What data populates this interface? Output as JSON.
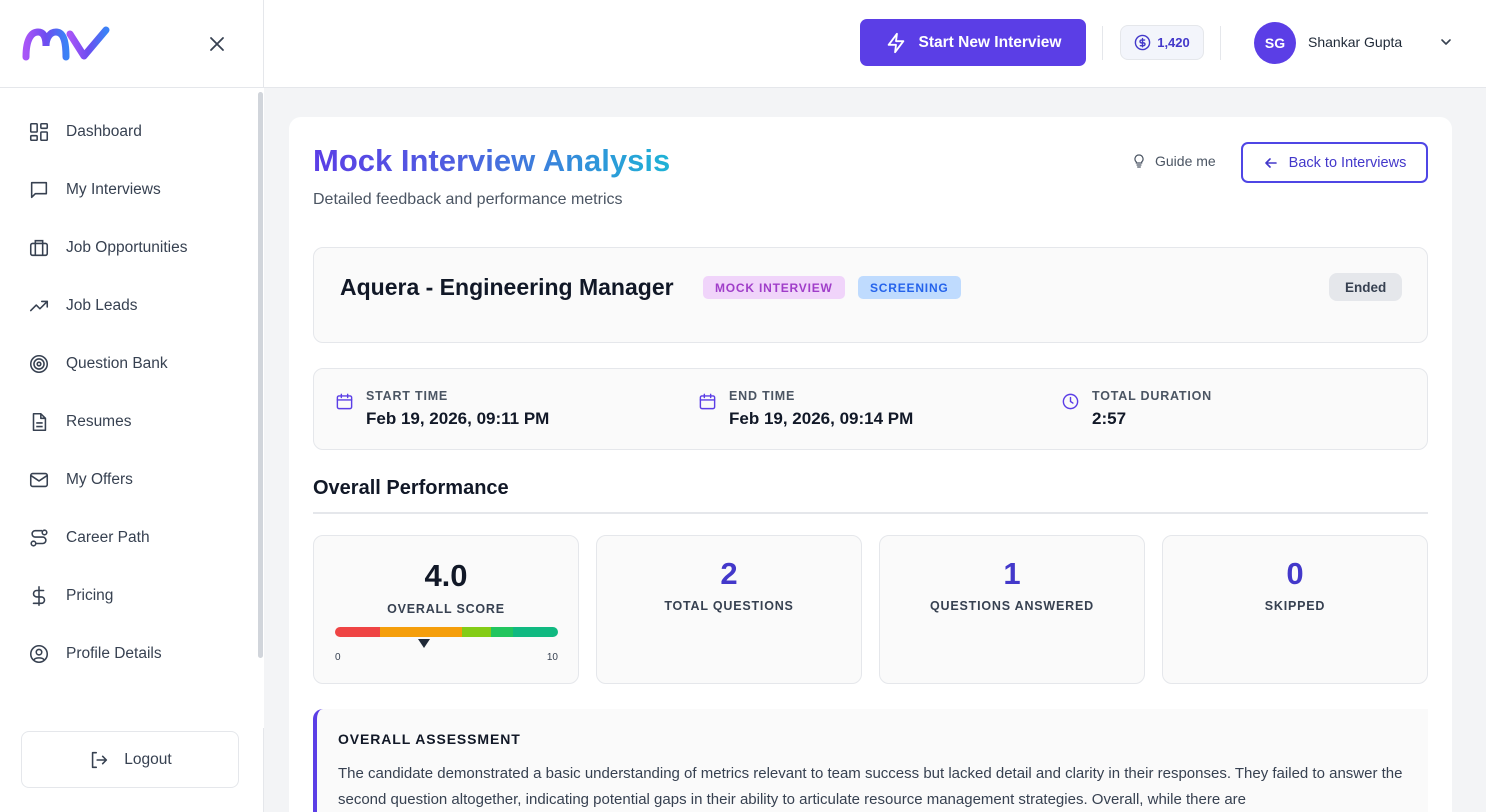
{
  "sidebar": {
    "items": [
      {
        "label": "Dashboard",
        "icon": "dashboard-icon"
      },
      {
        "label": "My Interviews",
        "icon": "chat-bubble-icon"
      },
      {
        "label": "Job Opportunities",
        "icon": "briefcase-icon"
      },
      {
        "label": "Job Leads",
        "icon": "trending-up-icon"
      },
      {
        "label": "Question Bank",
        "icon": "target-icon"
      },
      {
        "label": "Resumes",
        "icon": "document-icon"
      },
      {
        "label": "My Offers",
        "icon": "mail-icon"
      },
      {
        "label": "Career Path",
        "icon": "route-icon"
      },
      {
        "label": "Pricing",
        "icon": "dollar-icon"
      },
      {
        "label": "Profile Details",
        "icon": "user-circle-icon"
      }
    ],
    "logout_label": "Logout"
  },
  "topbar": {
    "start_label": "Start New Interview",
    "credits": "1,420",
    "avatar_initials": "SG",
    "username": "Shankar Gupta"
  },
  "page": {
    "title": "Mock Interview Analysis",
    "subtitle": "Detailed feedback and performance metrics",
    "guide_label": "Guide me",
    "back_label": "Back to Interviews"
  },
  "interview": {
    "title": "Aquera - Engineering Manager",
    "badge_type": "MOCK INTERVIEW",
    "badge_stage": "SCREENING",
    "status": "Ended"
  },
  "times": {
    "start_label": "START TIME",
    "start_value": "Feb 19, 2026, 09:11 PM",
    "end_label": "END TIME",
    "end_value": "Feb 19, 2026, 09:14 PM",
    "duration_label": "TOTAL DURATION",
    "duration_value": "2:57"
  },
  "performance": {
    "section_title": "Overall Performance",
    "score": "4.0",
    "score_label": "OVERALL SCORE",
    "score_value": 4.0,
    "scale_min": "0",
    "scale_max": "10",
    "total_questions": "2",
    "total_questions_label": "TOTAL QUESTIONS",
    "answered": "1",
    "answered_label": "QUESTIONS ANSWERED",
    "skipped": "0",
    "skipped_label": "SKIPPED"
  },
  "assessment": {
    "title": "OVERALL ASSESSMENT",
    "text": "The candidate demonstrated a basic understanding of metrics relevant to team success but lacked detail and clarity in their responses. They failed to answer the second question altogether, indicating potential gaps in their ability to articulate resource management strategies. Overall, while there are"
  },
  "colors": {
    "accent": "#5b3ee6",
    "link": "#4338ca",
    "gauge": [
      "#ef4444",
      "#f59e0b",
      "#84cc16",
      "#22c55e",
      "#10b981"
    ]
  }
}
